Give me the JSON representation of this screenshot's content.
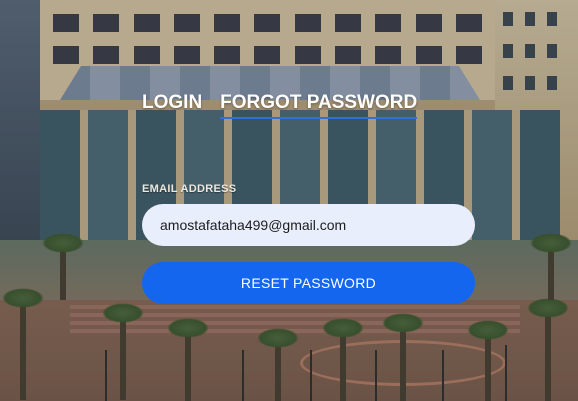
{
  "tabs": [
    {
      "label": "LOGIN",
      "active": false
    },
    {
      "label": "FORGOT PASSWORD",
      "active": true
    }
  ],
  "form": {
    "email_label": "EMAIL ADDRESS",
    "email_value": "amostafataha499@gmail.com",
    "submit_label": "RESET PASSWORD"
  },
  "colors": {
    "accent": "#1466ef",
    "input_bg": "#e8eefc",
    "tab_underline": "#2f6fe0"
  }
}
